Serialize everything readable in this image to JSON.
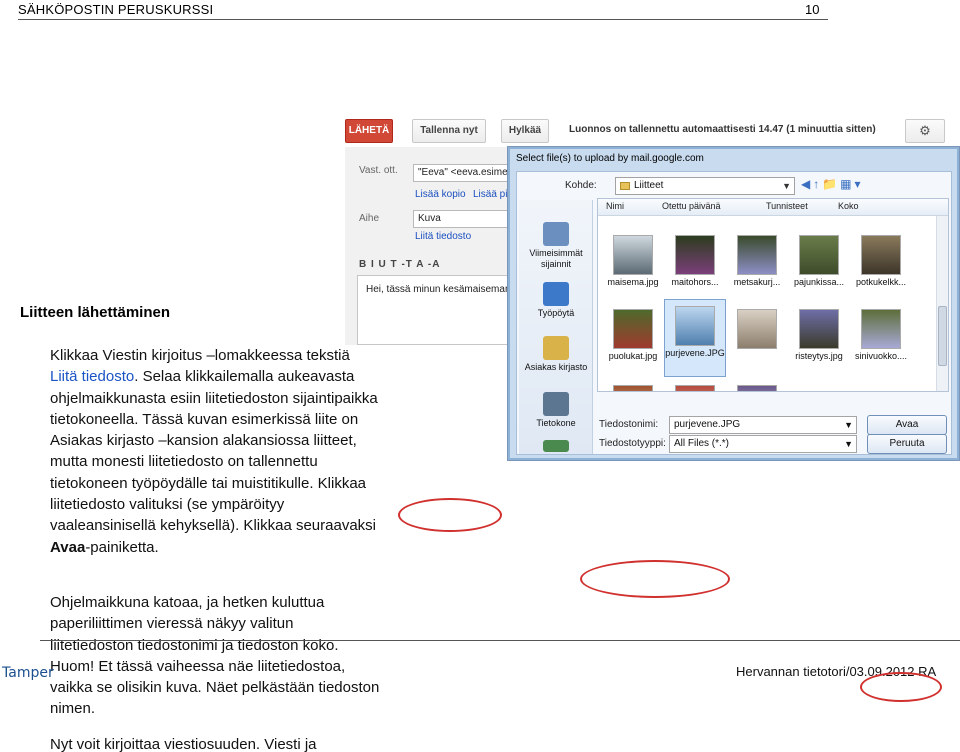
{
  "header": {
    "title": "SÄHKÖPOSTIN PERUSKURSSI",
    "page_number": "10"
  },
  "section_heading": "Liitteen lähettäminen",
  "paragraphs": {
    "p1_part1": "Klikkaa Viestin kirjoitus –lomakkeessa tekstiä",
    "p1_link": "Liitä tiedosto",
    "p1_part2": ". Selaa klikkailemalla aukeavasta ohjelmaikkunasta esiin liitetiedoston sijaintipaikka tietokoneella. Tässä kuvan esimerkissä liite on Asiakas kirjasto –kansion alakansiossa liitteet, mutta monesti liitetiedosto on tallennettu tietokoneen työpöydälle tai muistitikulle. Klikkaa liitetiedosto valituksi (se ympäröityy vaaleansinisellä kehyksellä). Klikkaa seuraavaksi ",
    "p1_bold": "Avaa",
    "p1_part3": "-painiketta.",
    "p2": "Ohjelmaikkuna katoaa, ja hetken kuluttua paperiliittimen vieressä näkyy valitun liitetiedoston tiedostonimi ja tiedoston koko. Huom! Et tässä vaiheessa näe liitetiedostoa, vaikka se olisikin kuva. Näet pelkästään tiedoston nimen.",
    "p3": "Nyt voit kirjoittaa viestiosuuden. Viesti ja"
  },
  "footer": {
    "logo_text": "Tamper",
    "right_text": "Hervannan tietotori/03.09.2012 RA"
  },
  "gmail": {
    "send_label": "LÄHETÄ",
    "save_label": "Tallenna nyt",
    "discard_label": "Hylkää",
    "status": "Luonnos on tallennettu automaattisesti 14.47 (1 minuuttia sitten)",
    "to_label": "Vast. ott.",
    "to_value": "\"Eeva\" <eeva.esimerk",
    "add_cc": "Lisää kopio",
    "add_bcc": "Lisää piilo",
    "subject_label": "Aihe",
    "subject_value": "Kuva",
    "attach_link": "Liitä tiedosto",
    "format_bar": "B  I  U  T  ‑T  A  ‑A",
    "body_text": "Hei, tässä minun kesämaisemani"
  },
  "dialog": {
    "title": "Select file(s) to upload by mail.google.com",
    "lookin_label": "Kohde:",
    "lookin_value": "Liitteet",
    "places": [
      {
        "label": "Viimeisimmät sijainnit",
        "color": "#6b8fbf"
      },
      {
        "label": "Työpöytä",
        "color": "#3c7ac9"
      },
      {
        "label": "Asiakas kirjasto",
        "color": "#d9b24a"
      },
      {
        "label": "Tietokone",
        "color": "#5c7590"
      }
    ],
    "columns": [
      "Nimi",
      "Otettu päivänä",
      "Tunnisteet",
      "Koko"
    ],
    "files_row1": [
      "maisema.jpg",
      "maitohors...",
      "metsakurj...",
      "pajunkissa...",
      "potkukelkk..."
    ],
    "files_row2": [
      "puolukat.jpg",
      "purjevene.JPG",
      "",
      "risteytys.jpg",
      "sinivuokko...."
    ],
    "filename_label": "Tiedostonimi:",
    "filename_value": "purjevene.JPG",
    "filetype_label": "Tiedostotyyppi:",
    "filetype_value": "All Files (*.*)",
    "open_label": "Avaa",
    "cancel_label": "Peruuta"
  }
}
